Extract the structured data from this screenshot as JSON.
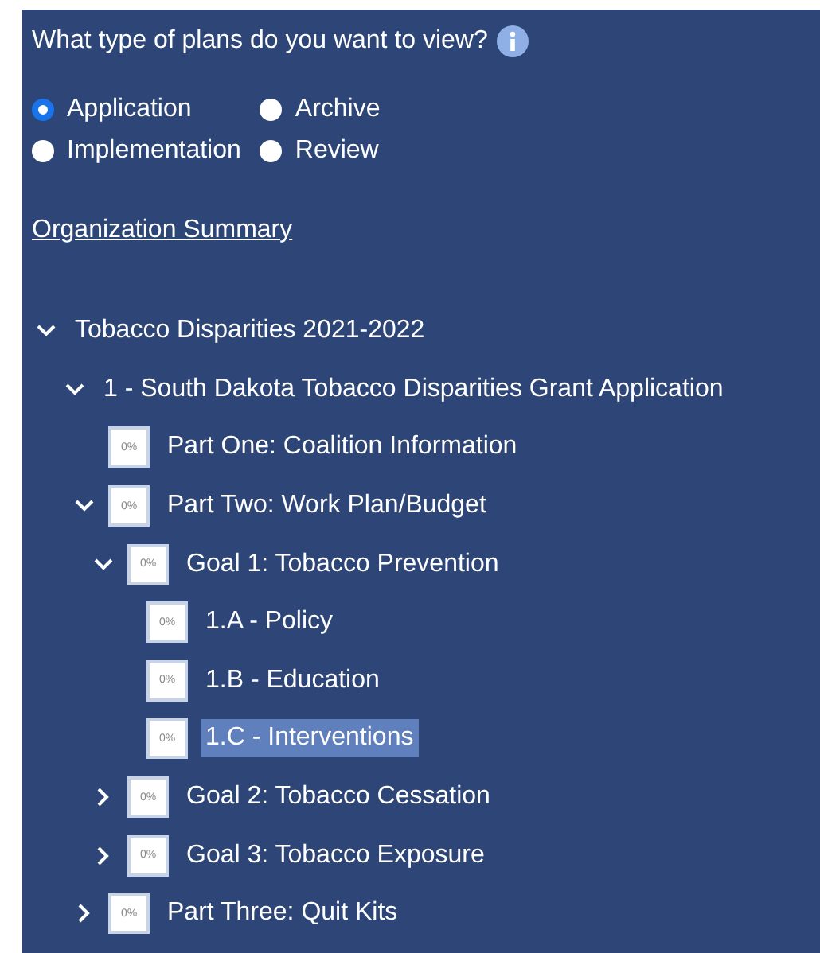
{
  "question": {
    "text": "What type of plans do you want to view?"
  },
  "plan_types": [
    {
      "label": "Application",
      "selected": true
    },
    {
      "label": "Archive",
      "selected": false
    },
    {
      "label": "Implementation",
      "selected": false
    },
    {
      "label": "Review",
      "selected": false
    }
  ],
  "summary_link": "Organization Summary",
  "tree": [
    {
      "label": "Tobacco Disparities 2021-2022",
      "expanded": true,
      "selected": false,
      "children": [
        {
          "label": "1 - South Dakota Tobacco Disparities Grant Application",
          "expanded": true,
          "selected": false,
          "children": [
            {
              "label": "Part One: Coalition Information",
              "badge": "0%",
              "selected": false
            },
            {
              "label": "Part Two: Work Plan/Budget",
              "badge": "0%",
              "expanded": true,
              "selected": false,
              "children": [
                {
                  "label": "Goal 1: Tobacco Prevention",
                  "badge": "0%",
                  "expanded": true,
                  "selected": false,
                  "children": [
                    {
                      "label": "1.A - Policy",
                      "badge": "0%",
                      "selected": false
                    },
                    {
                      "label": "1.B - Education",
                      "badge": "0%",
                      "selected": false
                    },
                    {
                      "label": "1.C - Interventions",
                      "badge": "0%",
                      "selected": true
                    }
                  ]
                },
                {
                  "label": "Goal 2: Tobacco Cessation",
                  "badge": "0%",
                  "expanded": false,
                  "selected": false
                },
                {
                  "label": "Goal 3: Tobacco Exposure",
                  "badge": "0%",
                  "expanded": false,
                  "selected": false
                }
              ]
            },
            {
              "label": "Part Three: Quit Kits",
              "badge": "0%",
              "expanded": false,
              "selected": false
            }
          ]
        }
      ]
    }
  ]
}
